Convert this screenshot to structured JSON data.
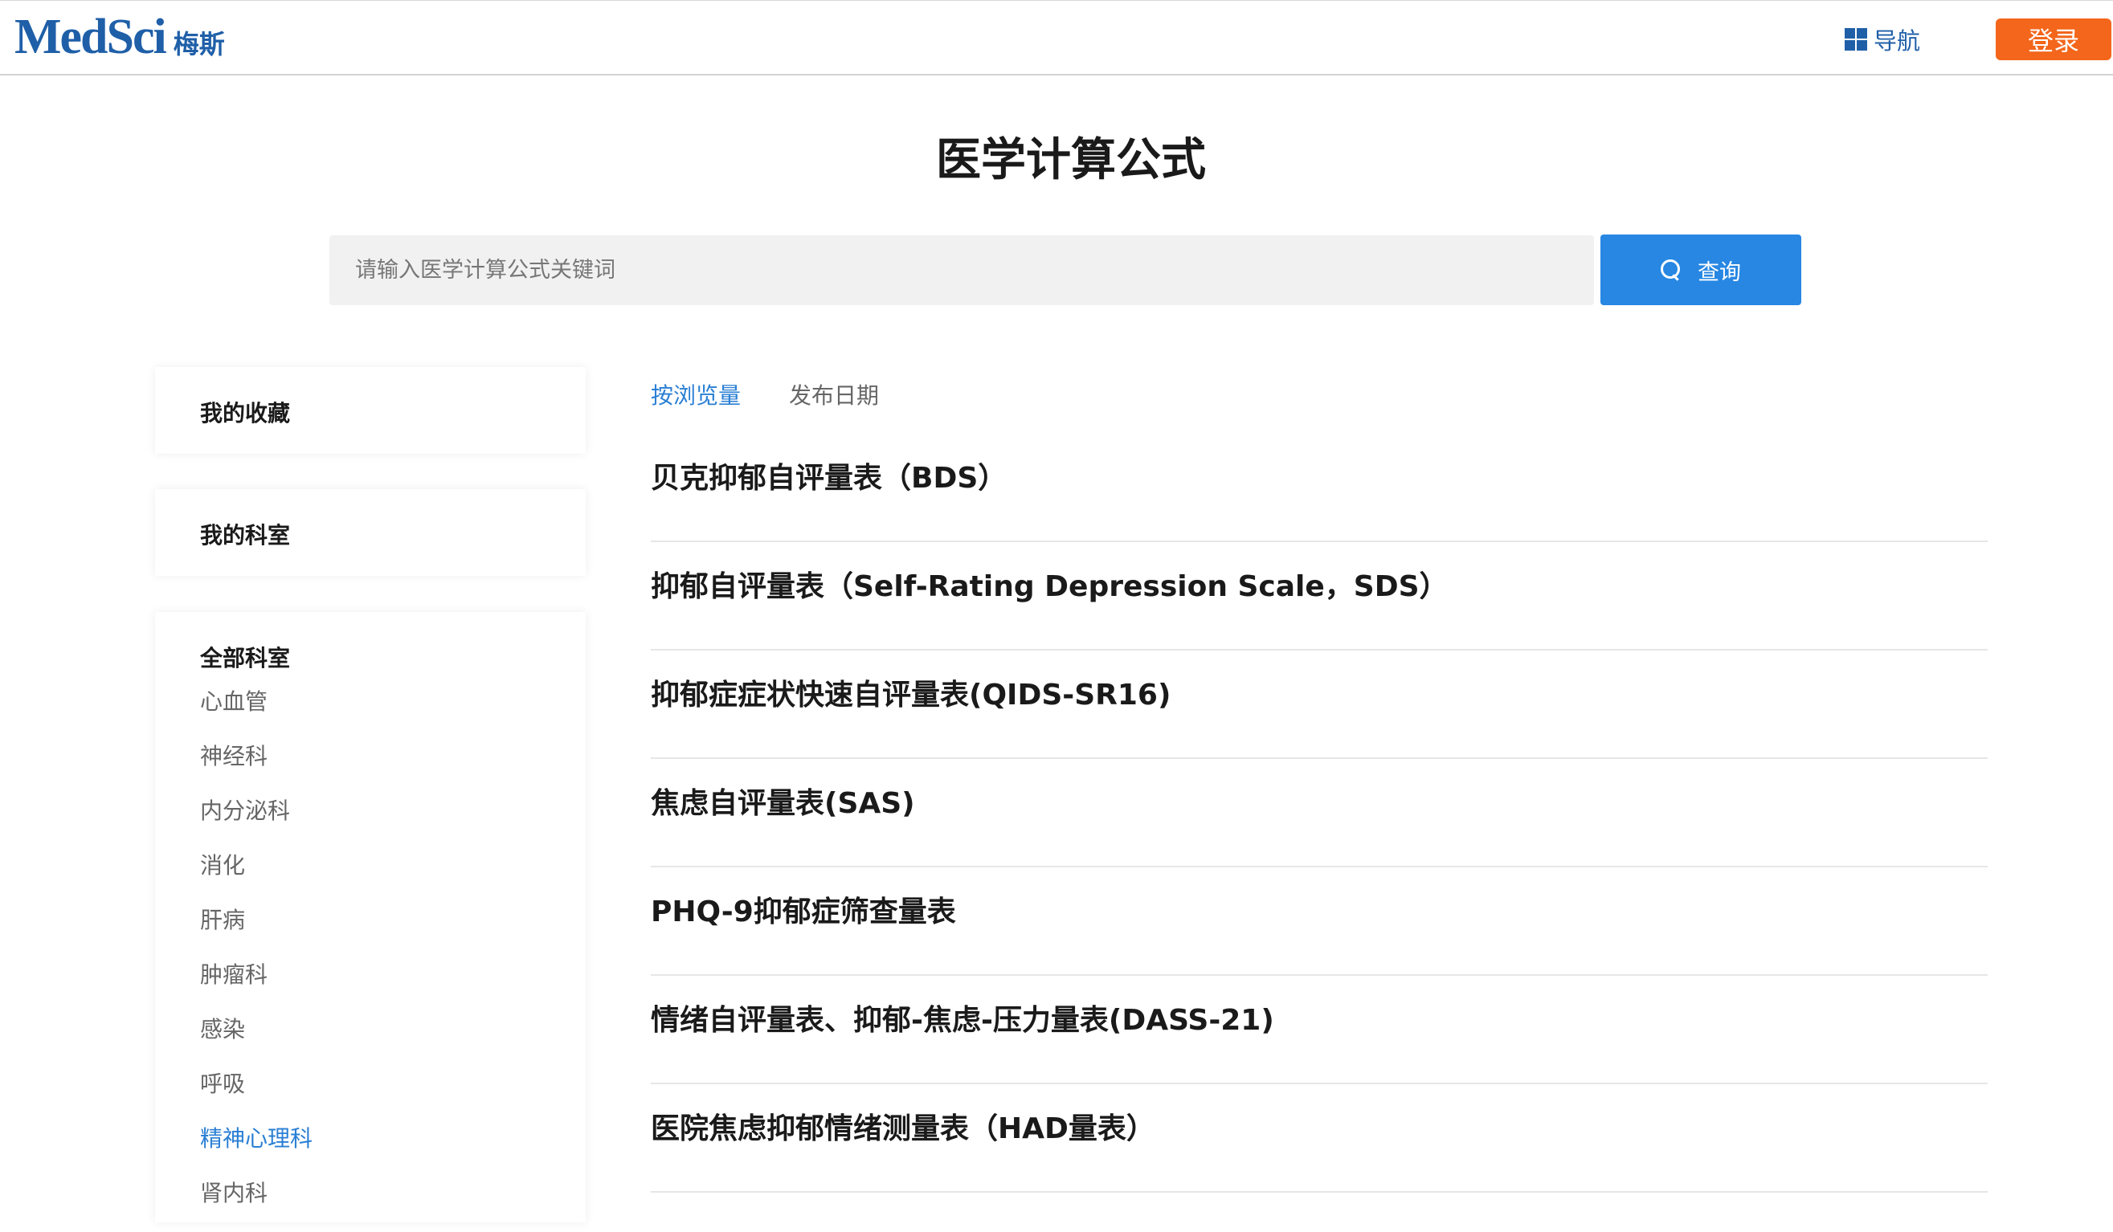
{
  "header": {
    "logo_main": "MedSci",
    "logo_sub": "梅斯",
    "nav_label": "导航",
    "login_label": "登录"
  },
  "page": {
    "title": "医学计算公式"
  },
  "search": {
    "placeholder": "请输入医学计算公式关键词",
    "button_label": "查询"
  },
  "sidebar": {
    "favorites_label": "我的收藏",
    "my_departments_label": "我的科室",
    "all_departments_label": "全部科室",
    "departments": [
      {
        "label": "心血管",
        "active": false
      },
      {
        "label": "神经科",
        "active": false
      },
      {
        "label": "内分泌科",
        "active": false
      },
      {
        "label": "消化",
        "active": false
      },
      {
        "label": "肝病",
        "active": false
      },
      {
        "label": "肿瘤科",
        "active": false
      },
      {
        "label": "感染",
        "active": false
      },
      {
        "label": "呼吸",
        "active": false
      },
      {
        "label": "精神心理科",
        "active": true
      },
      {
        "label": "肾内科",
        "active": false
      }
    ]
  },
  "sort": {
    "tabs": [
      {
        "label": "按浏览量",
        "active": true
      },
      {
        "label": "发布日期",
        "active": false
      }
    ]
  },
  "formulas": [
    {
      "title": "贝克抑郁自评量表（BDS）"
    },
    {
      "title": "抑郁自评量表（Self-Rating Depression Scale，SDS）"
    },
    {
      "title": "抑郁症症状快速自评量表(QIDS-SR16)"
    },
    {
      "title": "焦虑自评量表(SAS)"
    },
    {
      "title": "PHQ-9抑郁症筛查量表"
    },
    {
      "title": "情绪自评量表、抑郁-焦虑-压力量表(DASS-21)"
    },
    {
      "title": "医院焦虑抑郁情绪测量表（HAD量表）"
    }
  ],
  "colors": {
    "brand": "#1f5fa8",
    "login": "#f3661b",
    "search_button": "#2787e3",
    "active": "#2a7fd4"
  }
}
